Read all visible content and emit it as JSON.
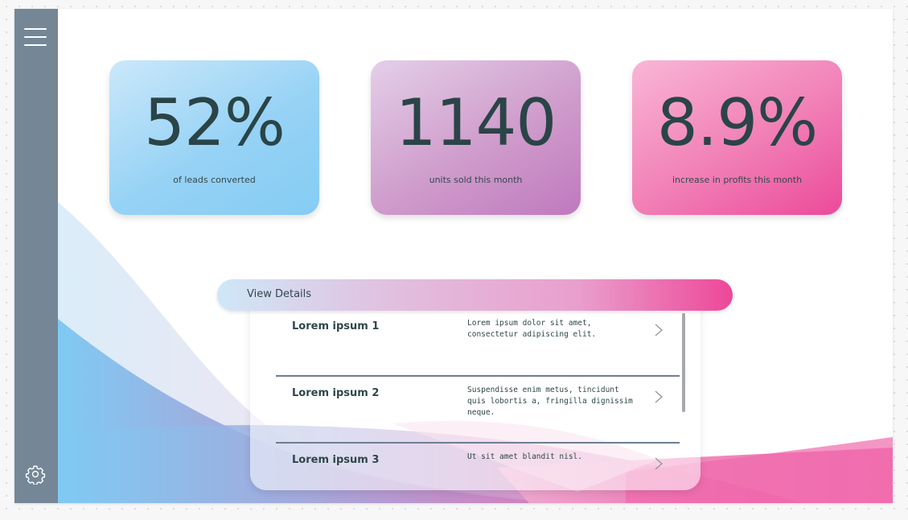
{
  "kpis": [
    {
      "value": "52%",
      "label": "of leads converted"
    },
    {
      "value": "1140",
      "label": "units sold this month"
    },
    {
      "value": "8.9%",
      "label": "increase in profits this month"
    }
  ],
  "details": {
    "button_label": "View Details",
    "items": [
      {
        "title": "Lorem ipsum 1",
        "description": "Lorem ipsum dolor sit amet, consectetur adipiscing elit."
      },
      {
        "title": "Lorem ipsum 2",
        "description": "Suspendisse enim metus, tincidunt quis lobortis a, fringilla dignissim neque."
      },
      {
        "title": "Lorem ipsum 3",
        "description": "Ut sit amet blandit nisl."
      }
    ]
  },
  "icons": {
    "menu": "hamburger-menu-icon",
    "settings": "gear-icon",
    "row_arrow": "chevron-right-icon"
  },
  "colors": {
    "sidebar": "#758797",
    "text": "#2a4447",
    "blue_accent": "#85ccf4",
    "purple_accent": "#c079bf",
    "pink_accent": "#ec4a9a"
  }
}
